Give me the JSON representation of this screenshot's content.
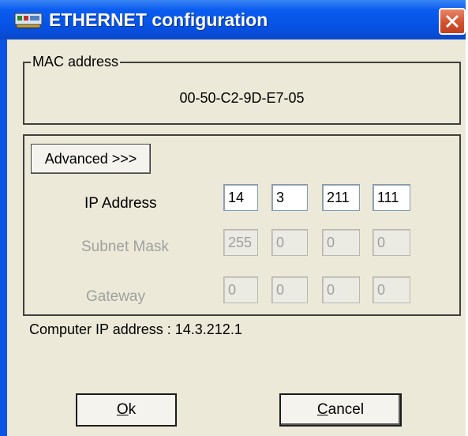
{
  "window": {
    "title": "ETHERNET configuration",
    "icons": {
      "app": "network-card-icon",
      "close": "close-icon"
    },
    "colors": {
      "titlebar": "#0a54e4",
      "close_button": "#d4522e",
      "client": "#ece9d8"
    }
  },
  "mac": {
    "legend": "MAC address",
    "value": "00-50-C2-9D-E7-05"
  },
  "ip_group": {
    "advanced_label": "Advanced >>>",
    "ip_address": {
      "label": "IP Address",
      "octets": [
        "14",
        "3",
        "211",
        "111"
      ],
      "enabled": true
    },
    "subnet_mask": {
      "label": "Subnet Mask",
      "octets": [
        "255",
        "0",
        "0",
        "0"
      ],
      "enabled": false
    },
    "gateway": {
      "label": "Gateway",
      "octets": [
        "0",
        "0",
        "0",
        "0"
      ],
      "enabled": false
    }
  },
  "computer_ip": "Computer IP address : 14.3.212.1",
  "buttons": {
    "ok": {
      "mnemonic": "O",
      "rest": "k"
    },
    "cancel": {
      "mnemonic": "C",
      "rest": "ancel"
    }
  }
}
